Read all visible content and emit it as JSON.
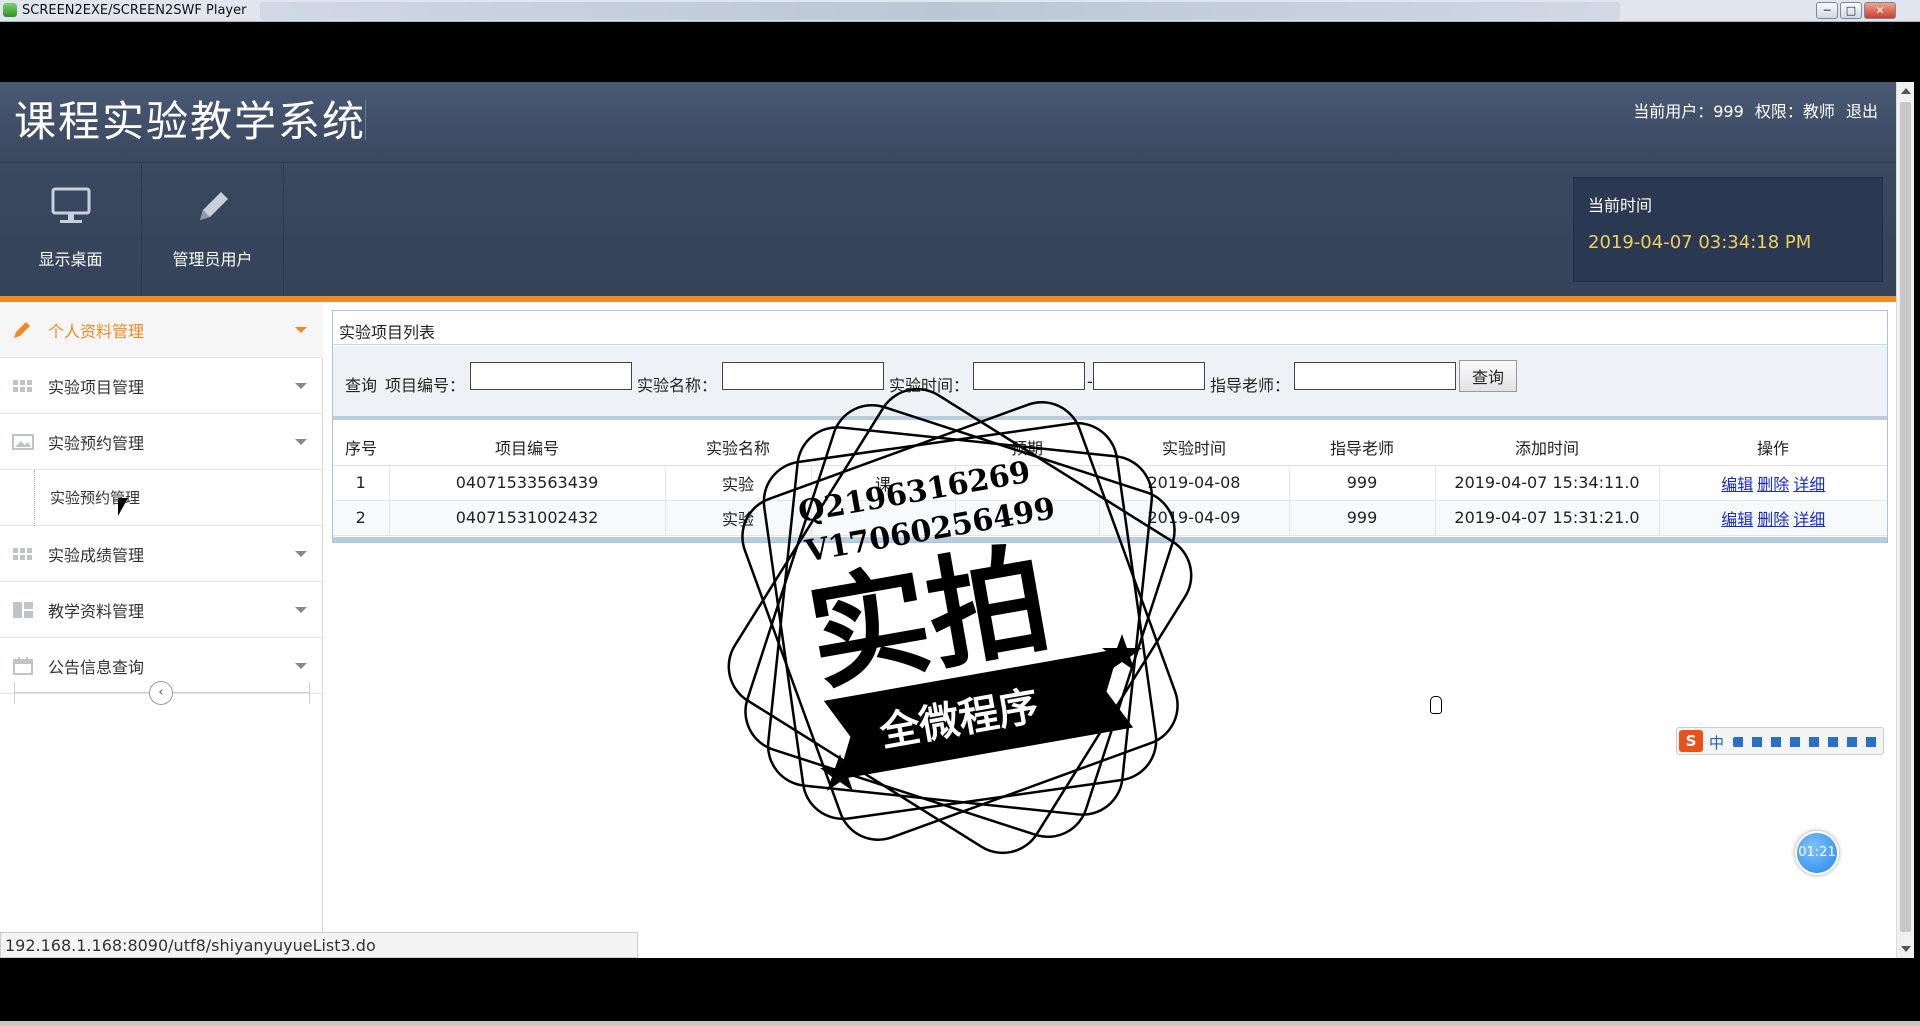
{
  "player": {
    "title": "SCREEN2EXE/SCREEN2SWF Player",
    "min_label": "─",
    "max_label": "□",
    "close_label": "✕"
  },
  "header": {
    "title": "课程实验教学系统",
    "user_label": "当前用户：999",
    "role_label": "权限：教师",
    "logout_label": "退出",
    "nav": [
      {
        "label": "显示桌面",
        "icon": "monitor-icon"
      },
      {
        "label": "管理员用户",
        "icon": "pencil-icon"
      }
    ],
    "time_label": "当前时间",
    "time_value": "2019-04-07 03:34:18 PM"
  },
  "sidebar": {
    "items": [
      {
        "label": "个人资料管理",
        "icon": "pencil-icon",
        "active": true
      },
      {
        "label": "实验项目管理",
        "icon": "grid-icon"
      },
      {
        "label": "实验预约管理",
        "icon": "image-icon"
      },
      {
        "label": "实验成绩管理",
        "icon": "grid-icon"
      },
      {
        "label": "教学资料管理",
        "icon": "layout-icon"
      },
      {
        "label": "公告信息查询",
        "icon": "calendar-icon"
      }
    ],
    "sub_item": "实验预约管理",
    "collapse_label": "‹"
  },
  "panel": {
    "title": "实验项目列表",
    "search": {
      "query_label": "查询",
      "code_label": "项目编号：",
      "name_label": "实验名称：",
      "time_label": "实验时间：",
      "range_sep": "-",
      "teacher_label": "指导老师：",
      "button_label": "查询"
    },
    "columns": [
      "序号",
      "项目编号",
      "实验名称",
      "",
      "预期",
      "实验时间",
      "指导老师",
      "添加时间",
      "操作"
    ],
    "rows": [
      {
        "no": "1",
        "code": "04071533563439",
        "name": "实验",
        "col4": "课",
        "col5": "",
        "time": "2019-04-08",
        "teacher": "999",
        "added": "2019-04-07 15:34:11.0"
      },
      {
        "no": "2",
        "code": "04071531002432",
        "name": "实验",
        "col4": "",
        "col5": "",
        "time": "2019-04-09",
        "teacher": "999",
        "added": "2019-04-07 15:31:21.0"
      }
    ],
    "actions": {
      "edit": "编辑",
      "delete": "删除",
      "detail": "详细"
    }
  },
  "status_url": "192.168.1.168:8090/utf8/shiyanyuyueList3.do",
  "ime": {
    "logo": "S",
    "lang": "中"
  },
  "timer": "01:21",
  "watermark": {
    "line1": "Q2196316269",
    "line2": "V17060256499",
    "big": "实拍",
    "banner": "全微程序"
  }
}
